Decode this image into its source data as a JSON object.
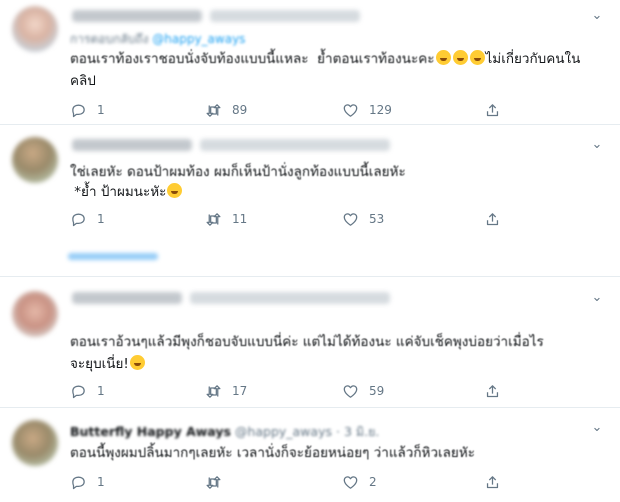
{
  "tweets": [
    {
      "reply_prefix": "การตอบกลับถึง",
      "reply_handle": "@happy_aways",
      "text": "ตอนเราท้องเราชอบนั่งจับท้องแบบนี้แหละ  ย้ำตอนเราท้องนะคะ",
      "text_tail": "ไม่เกี่ยวกับคนในคลิป",
      "replies": "1",
      "retweets": "89",
      "likes": "129"
    },
    {
      "text": "ใช่เลยหัะ ดอนป้าผมท้อง ผมก็เห็นป้านั่งลูกท้องแบบนี้เลยหัะ",
      "text_line2": " *ย้ำ ป้าผมนะหัะ",
      "replies": "1",
      "retweets": "11",
      "likes": "53"
    },
    {
      "text": "ตอนเราอ้วนๆแล้วมีพุงก็ชอบจับแบบนี่ค่ะ แต่ไม่ได้ท้องนะ แค่จับเช็คพุงบ่อยว่าเมื่อไร",
      "text_line2": "จะยุบเนี่ย!",
      "replies": "1",
      "retweets": "17",
      "likes": "59"
    },
    {
      "name": "Butterfly Happy Aways",
      "handle": "@happy_aways",
      "date": "3 มิ.ย.",
      "text": "ตอนนี้พุงผมปลิ้นมากๆเลยหัะ เวลานั่งก็จะย้อยหน่อยๆ ว่าแล้วก็หิวเลยหัะ",
      "replies": "1",
      "retweets": "",
      "likes": "2"
    }
  ],
  "icons": {
    "reply": "reply-icon",
    "retweet": "retweet-icon",
    "like": "heart-icon",
    "share": "share-icon",
    "more": "chevron-down-icon"
  },
  "colors": {
    "muted": "#657786",
    "link": "#1da1f2",
    "divider": "#e6ecf0"
  }
}
